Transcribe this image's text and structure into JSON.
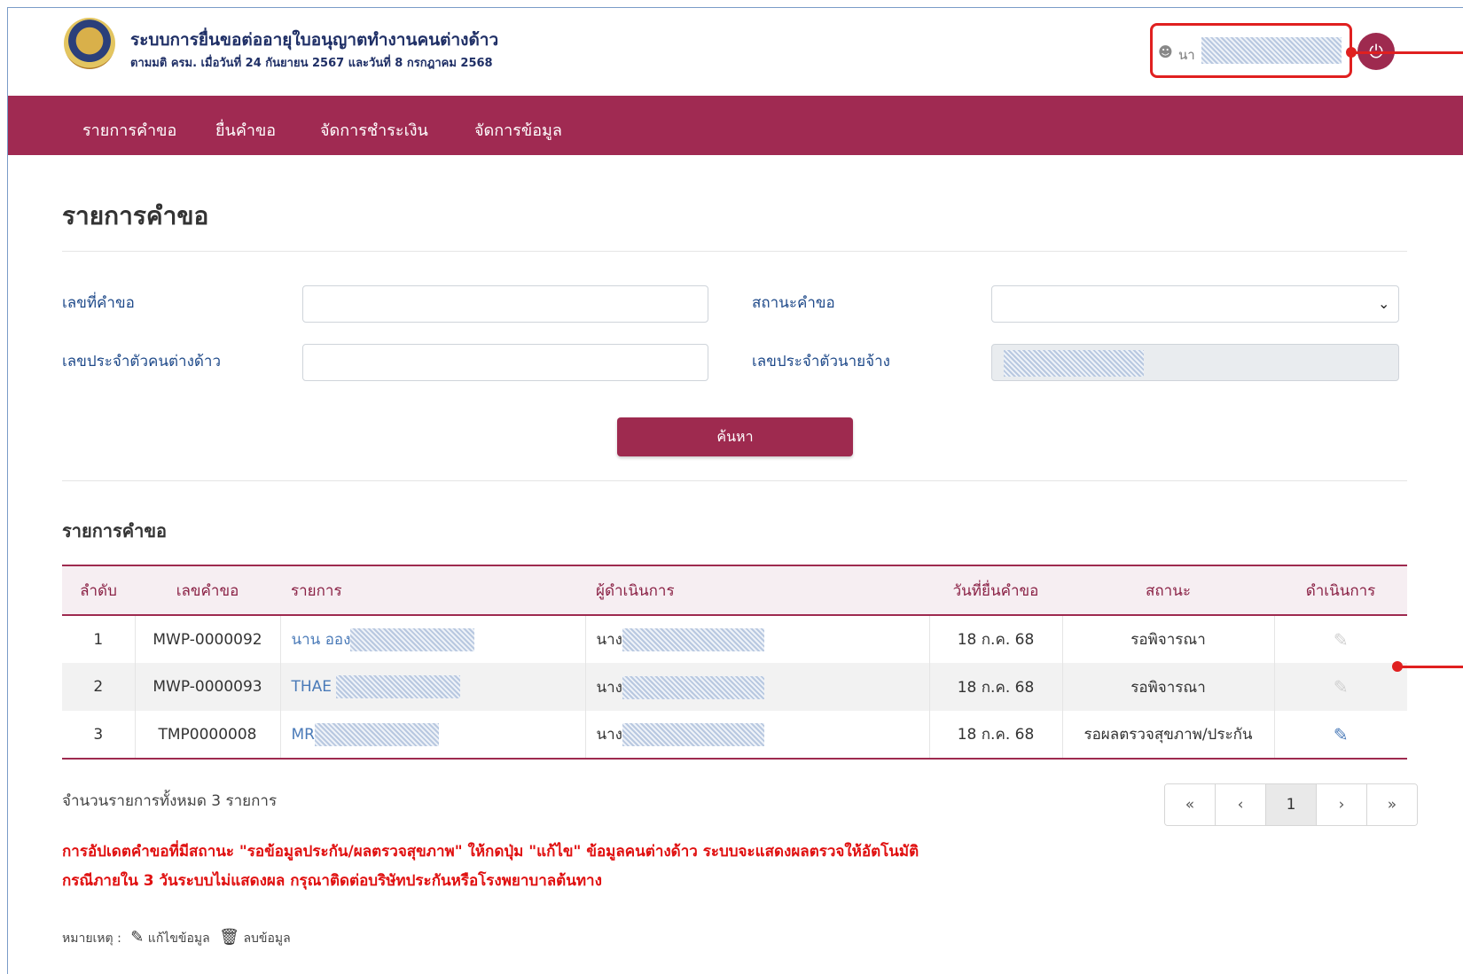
{
  "header": {
    "title": "ระบบการยื่นขอต่ออายุใบอนุญาตทำงานคนต่างด้าว",
    "subtitle": "ตามมติ ครม. เมื่อวันที่ 24 กันยายน 2567 และวันที่ 8 กรกฎาคม 2568",
    "user_prefix": "นา",
    "logout_icon": "power-icon"
  },
  "nav": {
    "items": [
      "รายการคำขอ",
      "ยื่นคำขอ",
      "จัดการชำระเงิน",
      "จัดการข้อมูล"
    ]
  },
  "page_title": "รายการคำขอ",
  "filters": {
    "request_no_label": "เลขที่คำขอ",
    "request_no_value": "",
    "status_label": "สถานะคำขอ",
    "status_value": "",
    "foreigner_id_label": "เลขประจำตัวคนต่างด้าว",
    "foreigner_id_value": "",
    "employer_id_label": "เลขประจำตัวนายจ้าง",
    "search_button": "ค้นหา"
  },
  "list": {
    "title": "รายการคำขอ",
    "columns": [
      "ลำดับ",
      "เลขคำขอ",
      "รายการ",
      "ผู้ดำเนินการ",
      "วันที่ยื่นคำขอ",
      "สถานะ",
      "ดำเนินการ"
    ],
    "rows": [
      {
        "no": "1",
        "request_no": "MWP-0000092",
        "item": "นาน ออง",
        "operator": "นาง",
        "date": "18 ก.ค. 68",
        "status": "รอพิจารณา",
        "editable": false
      },
      {
        "no": "2",
        "request_no": "MWP-0000093",
        "item": "THAE",
        "operator": "นาง",
        "date": "18 ก.ค. 68",
        "status": "รอพิจารณา",
        "editable": false
      },
      {
        "no": "3",
        "request_no": "TMP0000008",
        "item": "MR",
        "operator": "นาง",
        "date": "18 ก.ค. 68",
        "status": "รอผลตรวจสุขภาพ/ประกัน",
        "editable": true
      }
    ],
    "total_text": "จำนวนรายการทั้งหมด 3 รายการ"
  },
  "pagination": {
    "first": "«",
    "prev": "‹",
    "current": "1",
    "next": "›",
    "last": "»"
  },
  "notice": {
    "line1": "การอัปเดตคำขอที่มีสถานะ \"รอข้อมูลประกัน/ผลตรวจสุขภาพ\" ให้กดปุ่ม \"แก้ไข\" ข้อมูลคนต่างด้าว ระบบจะแสดงผลตรวจให้อัตโนมัติ",
    "line2": "กรณีภายใน 3 วันระบบไม่แสดงผล กรุณาติดต่อบริษัทประกันหรือโรงพยาบาลต้นทาง"
  },
  "legend": {
    "prefix": "หมายเหตุ :",
    "edit": "แก้ไขข้อมูล",
    "delete": "ลบข้อมูล"
  },
  "colors": {
    "brand": "#a02a52",
    "header_text": "#1f2f66",
    "label_text": "#1f4a8a",
    "notice_red": "#e01010",
    "annotation_red": "#e02020"
  }
}
